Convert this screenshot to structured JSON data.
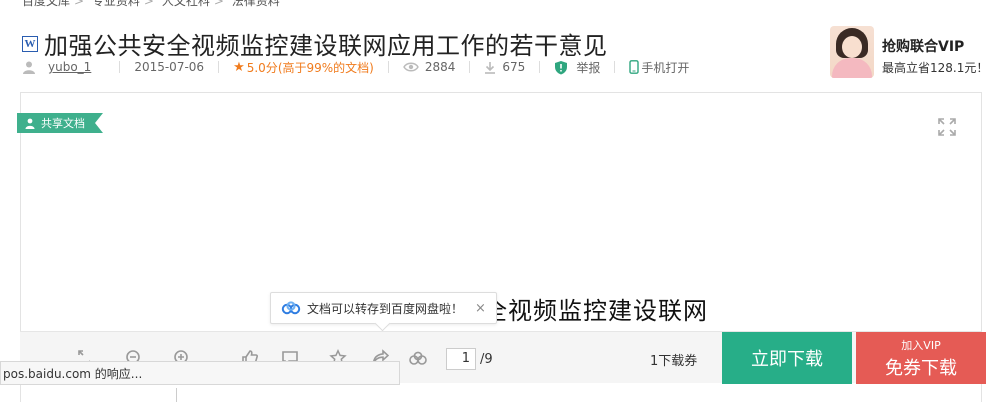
{
  "breadcrumb": {
    "items": [
      "百度文库",
      "专业资料",
      "人文社科",
      "法律资料"
    ],
    "separator": ">"
  },
  "document": {
    "title": "加强公共安全视频监控建设联网应用工作的若干意见",
    "author": "yubo_1",
    "date": "2015-07-06",
    "score": "5.0分",
    "score_note": "(高于99%的文档)",
    "views": "2884",
    "downloads": "675",
    "report_label": "举报",
    "phone_label": "手机打开",
    "share_tag": "共享文档",
    "visible_text": "全视频监控建设联网"
  },
  "vip_promo": {
    "title": "抢购联合VIP",
    "subtitle": "最高立省128.1元！"
  },
  "tooltip": {
    "text": "文档可以转存到百度网盘啦！",
    "close": "×"
  },
  "toolbar": {
    "page_current": "1",
    "page_total": "/9",
    "ticket_label": "1下载券",
    "download_button": "立即下载",
    "vip_button_top": "加入VIP",
    "vip_button_main": "免券下载"
  },
  "status_bar": {
    "text": "pos.baidu.com 的响应..."
  },
  "colors": {
    "green": "#27ae88",
    "red": "#e55b55",
    "orange": "#f07b1d",
    "word_blue": "#2a5db0"
  },
  "icons": [
    "word-icon",
    "user-icon",
    "star-icon",
    "eye-icon",
    "download-icon",
    "shield-icon",
    "phone-icon",
    "fullscreen-icon",
    "baidu-cloud-icon",
    "zoom-fit-icon",
    "zoom-out-icon",
    "zoom-in-icon",
    "thumbs-up-icon",
    "comment-icon",
    "favorite-icon",
    "share-icon",
    "save-cloud-icon"
  ]
}
